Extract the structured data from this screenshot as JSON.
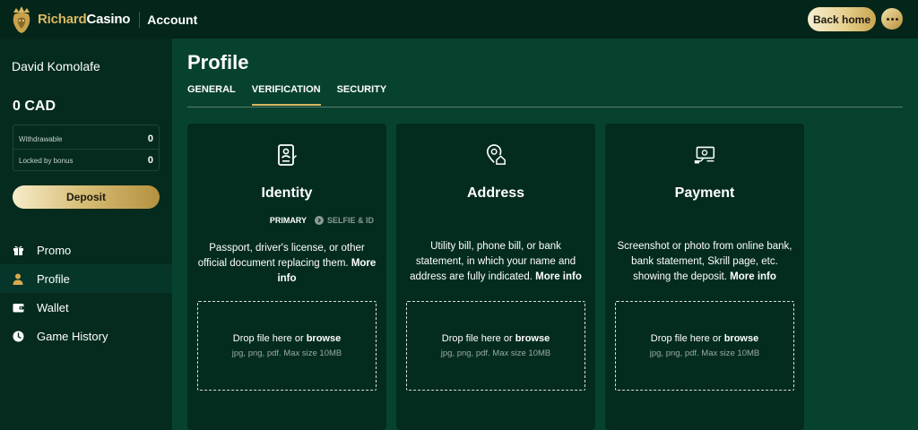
{
  "header": {
    "brand_part1": "Richard",
    "brand_part2": "Casino",
    "section": "Account",
    "back_home": "Back home",
    "logo_icon": "lion-crown-icon",
    "more_icon": "ellipsis-icon"
  },
  "sidebar": {
    "user_name": "David Komolafe",
    "balance": "0 CAD",
    "withdrawable_label": "Withdrawable",
    "withdrawable_value": "0",
    "locked_label": "Locked by bonus",
    "locked_value": "0",
    "deposit_label": "Deposit",
    "nav": [
      {
        "label": "Promo",
        "icon": "gift-icon",
        "active": false
      },
      {
        "label": "Profile",
        "icon": "user-icon",
        "active": true
      },
      {
        "label": "Wallet",
        "icon": "wallet-icon",
        "active": false
      },
      {
        "label": "Game History",
        "icon": "clock-icon",
        "active": false
      }
    ]
  },
  "main": {
    "title": "Profile",
    "tabs": [
      {
        "label": "GENERAL",
        "active": false
      },
      {
        "label": "VERIFICATION",
        "active": true
      },
      {
        "label": "SECURITY",
        "active": false
      }
    ],
    "cards": [
      {
        "title": "Identity",
        "icon": "id-badge-icon",
        "tag_primary": "PRIMARY",
        "tag_secondary": "SELFIE & ID",
        "description": "Passport, driver's license, or other official document replacing them.",
        "more_info": "More info",
        "drop_text": "Drop file here or",
        "browse": "browse",
        "hint": "jpg, png, pdf. Max size 10MB"
      },
      {
        "title": "Address",
        "icon": "location-home-icon",
        "description": "Utility bill, phone bill, or bank statement, in which your name and address are fully indicated.",
        "more_info": "More info",
        "drop_text": "Drop file here or",
        "browse": "browse",
        "hint": "jpg, png, pdf. Max size 10MB"
      },
      {
        "title": "Payment",
        "icon": "payment-screen-icon",
        "description": "Screenshot or photo from online bank, bank statement, Skrill page, etc. showing the deposit.",
        "more_info": "More info",
        "drop_text": "Drop file here or",
        "browse": "browse",
        "hint": "jpg, png, pdf. Max size 10MB"
      }
    ]
  },
  "colors": {
    "accent_gold": "#d9b862",
    "background": "#07422e",
    "sidebar": "#042b1d",
    "card": "#032c1e"
  }
}
